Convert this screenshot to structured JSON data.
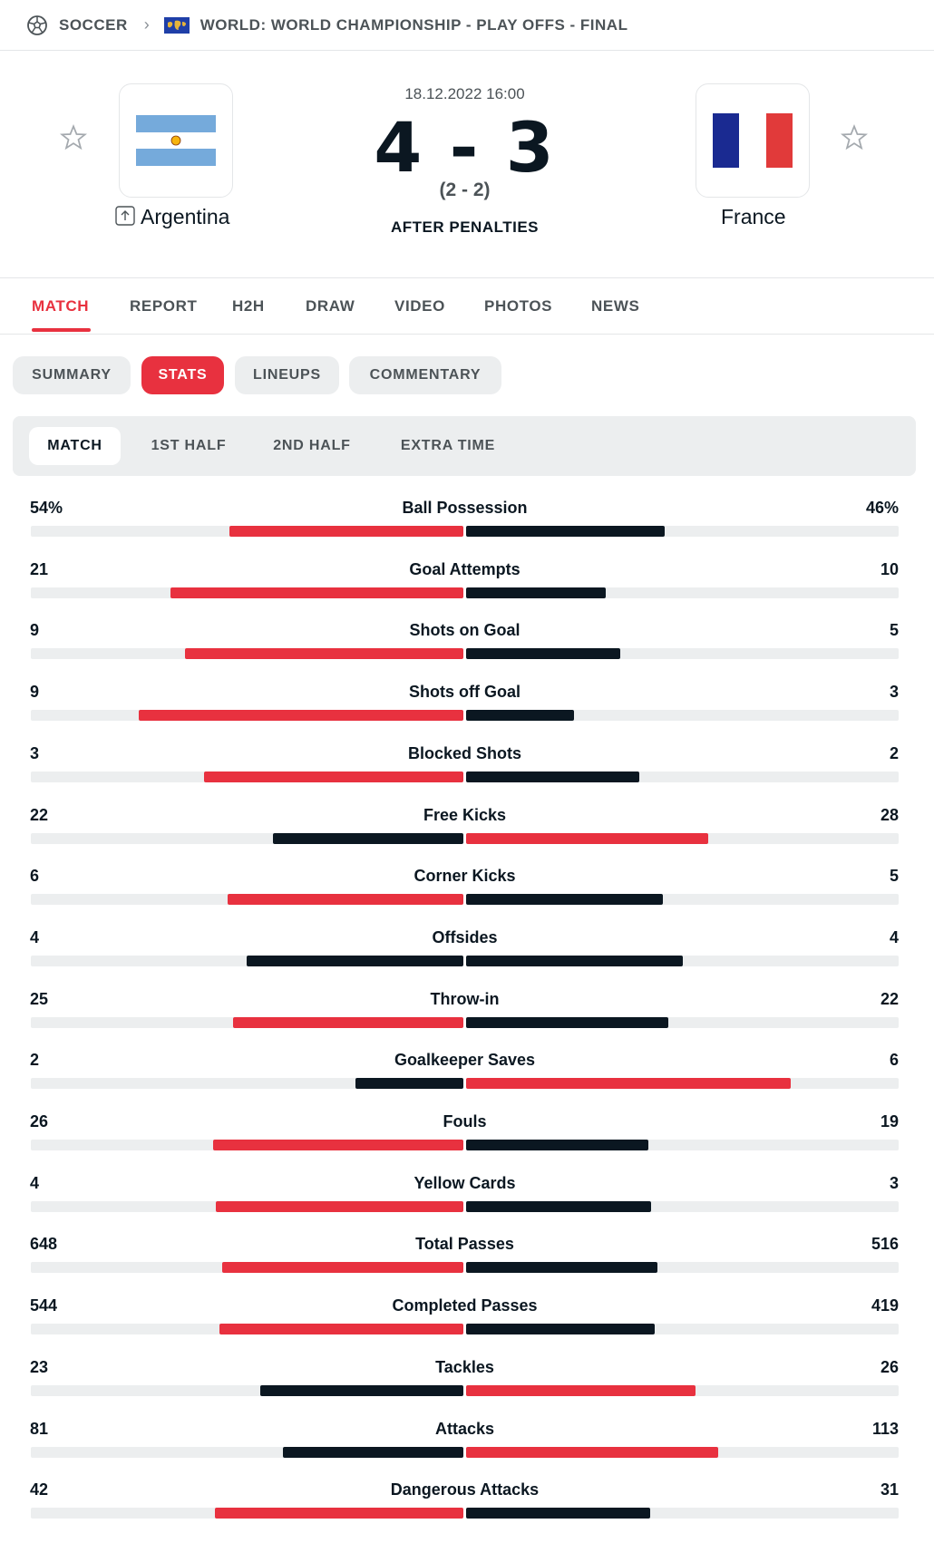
{
  "breadcrumb": {
    "sport": "SOCCER",
    "competition": "WORLD: WORLD CHAMPIONSHIP - PLAY OFFS - FINAL"
  },
  "match": {
    "date": "18.12.2022 16:00",
    "score": "4 - 3",
    "ht_score": "(2 - 2)",
    "status": "AFTER PENALTIES",
    "home": {
      "name": "Argentina"
    },
    "away": {
      "name": "France"
    }
  },
  "tabs": [
    "MATCH",
    "REPORT",
    "H2H",
    "DRAW",
    "VIDEO",
    "PHOTOS",
    "NEWS"
  ],
  "active_tab": "MATCH",
  "subtabs": [
    "SUMMARY",
    "STATS",
    "LINEUPS",
    "COMMENTARY"
  ],
  "active_subtab": "STATS",
  "periods": [
    "MATCH",
    "1ST HALF",
    "2ND HALF",
    "EXTRA TIME"
  ],
  "active_period": "MATCH",
  "colors": {
    "accent": "#e8313f",
    "dark": "#0b1721",
    "track": "#eceeef",
    "text_secondary": "#4c5357"
  },
  "stats": [
    {
      "label": "Ball Possession",
      "home": "54%",
      "away": "46%",
      "home_val": 54,
      "away_val": 46
    },
    {
      "label": "Goal Attempts",
      "home": "21",
      "away": "10",
      "home_val": 21,
      "away_val": 10
    },
    {
      "label": "Shots on Goal",
      "home": "9",
      "away": "5",
      "home_val": 9,
      "away_val": 5
    },
    {
      "label": "Shots off Goal",
      "home": "9",
      "away": "3",
      "home_val": 9,
      "away_val": 3
    },
    {
      "label": "Blocked Shots",
      "home": "3",
      "away": "2",
      "home_val": 3,
      "away_val": 2
    },
    {
      "label": "Free Kicks",
      "home": "22",
      "away": "28",
      "home_val": 22,
      "away_val": 28
    },
    {
      "label": "Corner Kicks",
      "home": "6",
      "away": "5",
      "home_val": 6,
      "away_val": 5
    },
    {
      "label": "Offsides",
      "home": "4",
      "away": "4",
      "home_val": 4,
      "away_val": 4
    },
    {
      "label": "Throw-in",
      "home": "25",
      "away": "22",
      "home_val": 25,
      "away_val": 22
    },
    {
      "label": "Goalkeeper Saves",
      "home": "2",
      "away": "6",
      "home_val": 2,
      "away_val": 6
    },
    {
      "label": "Fouls",
      "home": "26",
      "away": "19",
      "home_val": 26,
      "away_val": 19
    },
    {
      "label": "Yellow Cards",
      "home": "4",
      "away": "3",
      "home_val": 4,
      "away_val": 3
    },
    {
      "label": "Total Passes",
      "home": "648",
      "away": "516",
      "home_val": 648,
      "away_val": 516
    },
    {
      "label": "Completed Passes",
      "home": "544",
      "away": "419",
      "home_val": 544,
      "away_val": 419
    },
    {
      "label": "Tackles",
      "home": "23",
      "away": "26",
      "home_val": 23,
      "away_val": 26
    },
    {
      "label": "Attacks",
      "home": "81",
      "away": "113",
      "home_val": 81,
      "away_val": 113
    },
    {
      "label": "Dangerous Attacks",
      "home": "42",
      "away": "31",
      "home_val": 42,
      "away_val": 31
    }
  ]
}
